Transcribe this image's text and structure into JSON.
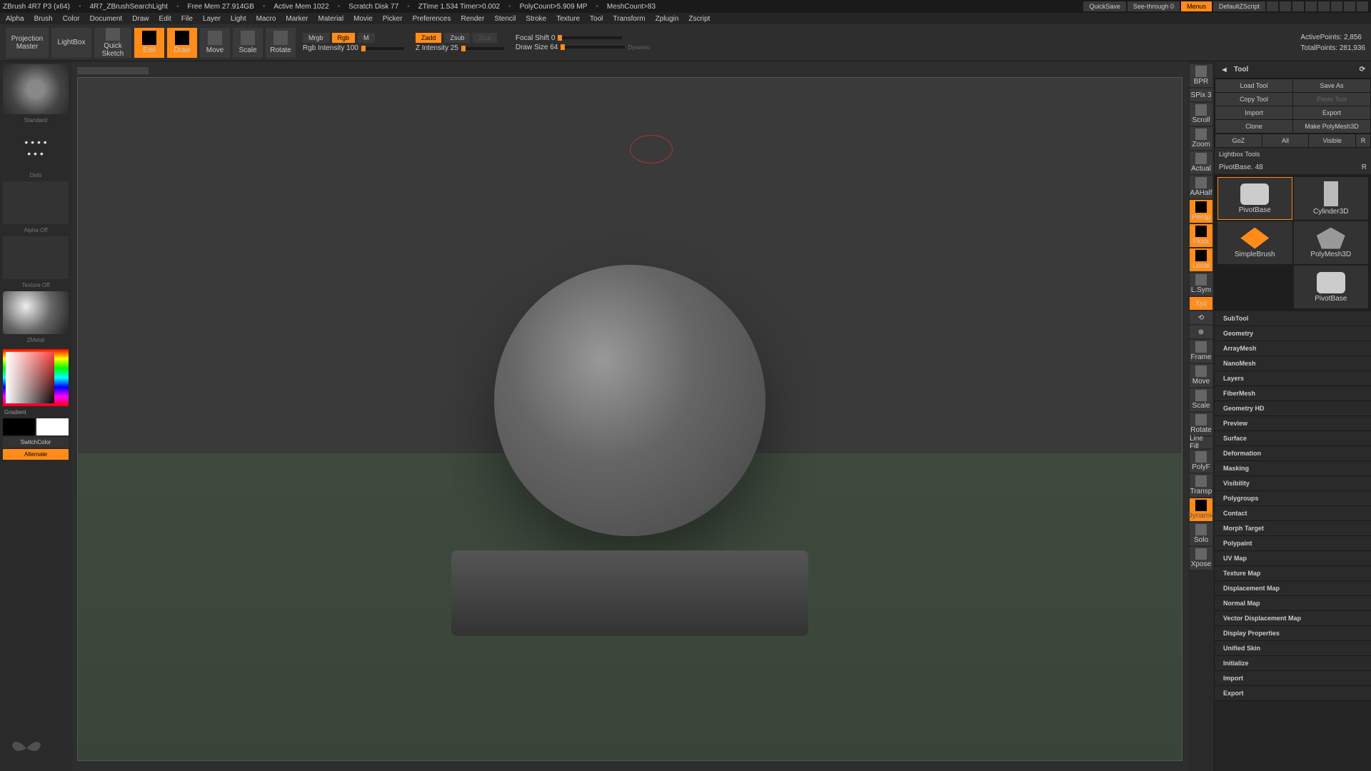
{
  "titlebar": {
    "app": "ZBrush 4R7 P3 (x64)",
    "doc": "4R7_ZBrushSearchLight",
    "freemem": "Free Mem 27.914GB",
    "activemem": "Active Mem 1022",
    "scratch": "Scratch Disk 77",
    "ztime": "ZTime 1.534 Timer>0.002",
    "polycount": "PolyCount>5.909 MP",
    "meshcount": "MeshCount>83",
    "quicksave": "QuickSave",
    "seethrough": "See-through  0",
    "menus": "Menus",
    "script": "DefaultZScript"
  },
  "menu": [
    "Alpha",
    "Brush",
    "Color",
    "Document",
    "Draw",
    "Edit",
    "File",
    "Layer",
    "Light",
    "Macro",
    "Marker",
    "Material",
    "Movie",
    "Picker",
    "Preferences",
    "Render",
    "Stencil",
    "Stroke",
    "Texture",
    "Tool",
    "Transform",
    "Zplugin",
    "Zscript"
  ],
  "toolbar": {
    "projection": "Projection\nMaster",
    "lightbox": "LightBox",
    "quicksketch": "Quick\nSketch",
    "edit": "Edit",
    "draw": "Draw",
    "move": "Move",
    "scale": "Scale",
    "rotate": "Rotate",
    "mrgb": "Mrgb",
    "rgb": "Rgb",
    "m": "M",
    "rgbintensity": "Rgb Intensity 100",
    "zadd": "Zadd",
    "zsub": "Zsub",
    "zcut": "Zcut",
    "zintensity": "Z Intensity 25",
    "focalshift": "Focal Shift 0",
    "drawsize": "Draw Size 64",
    "dynamic": "Dynamic",
    "activepoints": "ActivePoints:  2,856",
    "totalpoints": "TotalPoints:  281,936"
  },
  "left": {
    "brush": "Standard",
    "stroke": "Dots",
    "alpha": "Alpha  Off",
    "texture": "Texture  Off",
    "material": "ZMetal",
    "gradient": "Gradient",
    "switchcolor": "SwitchColor",
    "alternate": "Alternate"
  },
  "rail": {
    "bpr": "BPR",
    "spix": "SPix 3",
    "scroll": "Scroll",
    "zoom": "Zoom",
    "actual": "Actual",
    "aahalf": "AAHalf",
    "persp": "Persp",
    "floor": "Floor",
    "local": "Local",
    "lsym": "L.Sym",
    "xyz": "Xyz",
    "frame": "Frame",
    "move": "Move",
    "scale": "Scale",
    "rotate": "Rotate",
    "linefill": "Line Fill",
    "polyf": "PolyF",
    "transp": "Transp",
    "dynamic": "Dynamic",
    "solo": "Solo",
    "xpose": "Xpose"
  },
  "tool": {
    "title": "Tool",
    "loadtool": "Load Tool",
    "saveas": "Save As",
    "copytool": "Copy Tool",
    "pastetool": "Paste Tool",
    "import": "Import",
    "export": "Export",
    "clone": "Clone",
    "makepoly": "Make PolyMesh3D",
    "goz": "GoZ",
    "all": "All",
    "visible": "Visible",
    "r": "R",
    "lightboxtools": "Lightbox  Tools",
    "pivotbase": "PivotBase. 48",
    "thumbs": {
      "pivotbase": "PivotBase",
      "cylinder": "Cylinder3D",
      "simplebrush": "SimpleBrush",
      "polymesh": "PolyMesh3D",
      "pivot2": "PivotBase"
    }
  },
  "accordion": [
    "SubTool",
    "Geometry",
    "ArrayMesh",
    "NanoMesh",
    "Layers",
    "FiberMesh",
    "Geometry HD",
    "Preview",
    "Surface",
    "Deformation",
    "Masking",
    "Visibility",
    "Polygroups",
    "Contact",
    "Morph Target",
    "Polypaint",
    "UV Map",
    "Texture Map",
    "Displacement Map",
    "Normal Map",
    "Vector Displacement Map",
    "Display Properties",
    "Unified Skin",
    "Initialize",
    "Import",
    "Export"
  ]
}
